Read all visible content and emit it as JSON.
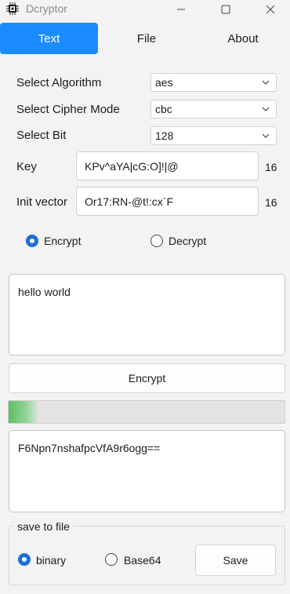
{
  "window": {
    "title": "Dcryptor"
  },
  "tabs": [
    {
      "label": "Text",
      "active": true
    },
    {
      "label": "File",
      "active": false
    },
    {
      "label": "About",
      "active": false
    }
  ],
  "form": {
    "algorithm": {
      "label": "Select Algorithm",
      "value": "aes"
    },
    "cipher_mode": {
      "label": "Select Cipher Mode",
      "value": "cbc"
    },
    "bit": {
      "label": "Select Bit",
      "value": "128"
    },
    "key": {
      "label": "Key",
      "value": "KPv^aYA|cG:O]!|@",
      "length": "16"
    },
    "init_vector": {
      "label": "Init vector",
      "value": "Or17:RN-@t!:cx`F",
      "length": "16"
    }
  },
  "mode": {
    "encrypt_label": "Encrypt",
    "decrypt_label": "Decrypt",
    "selected": "Encrypt"
  },
  "input_text": "hello world",
  "action_button": "Encrypt",
  "progress_percent": 11,
  "output_text": "F6Npn7nshafpcVfA9r6ogg==",
  "save": {
    "group_title": "save to file",
    "binary_label": "binary",
    "base64_label": "Base64",
    "selected": "binary",
    "button_label": "Save"
  },
  "colors": {
    "accent": "#1a8cff",
    "progress": "#5fbf64",
    "radio": "#1a6fd8"
  },
  "icons": [
    "app-chip-icon",
    "minimize-icon",
    "maximize-icon",
    "close-icon",
    "chevron-down-icon"
  ]
}
